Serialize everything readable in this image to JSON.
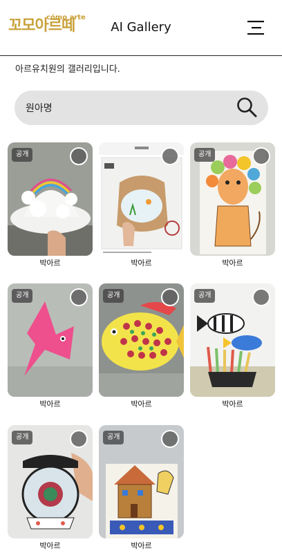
{
  "header": {
    "logo_text": "꼬모아르떼",
    "logo_sub": "cómo arte",
    "title": "AI Gallery",
    "menu_icon": "hamburger-menu-icon"
  },
  "intro_text": "아르유치원의 갤러리입니다.",
  "search": {
    "value": "원아명",
    "icon": "search-icon"
  },
  "gallery": [
    {
      "badge": "공개",
      "name": "박아르"
    },
    {
      "badge": "",
      "name": "박아르"
    },
    {
      "badge": "공개",
      "name": "박아르"
    },
    {
      "badge": "공개",
      "name": "박아르"
    },
    {
      "badge": "공개",
      "name": "박아르"
    },
    {
      "badge": "공개",
      "name": "박아르"
    },
    {
      "badge": "공개",
      "name": "박아르"
    },
    {
      "badge": "공개",
      "name": "박아르"
    }
  ]
}
